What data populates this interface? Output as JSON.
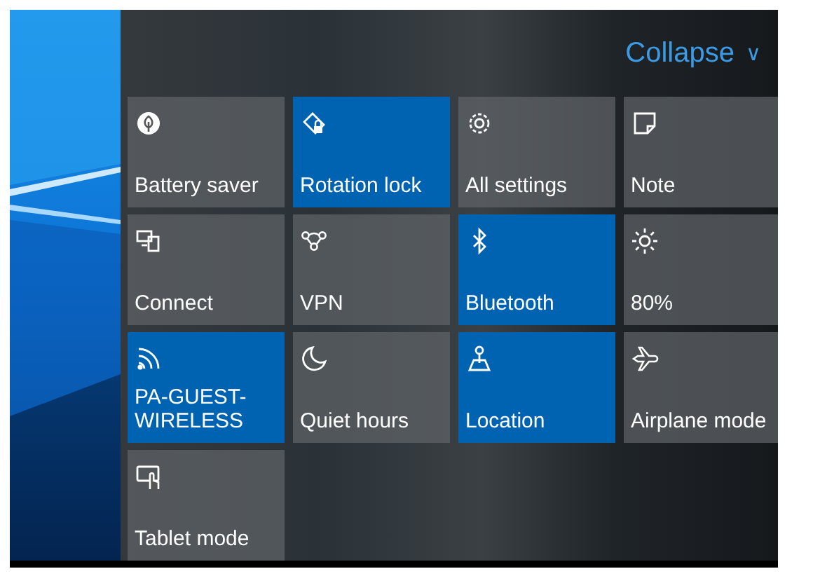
{
  "collapse": {
    "label": "Collapse",
    "caret": "∨"
  },
  "tiles": [
    {
      "label": "Battery saver",
      "on": false
    },
    {
      "label": "Rotation lock",
      "on": true
    },
    {
      "label": "All settings",
      "on": false
    },
    {
      "label": "Note",
      "on": false
    },
    {
      "label": "Connect",
      "on": false
    },
    {
      "label": "VPN",
      "on": false
    },
    {
      "label": "Bluetooth",
      "on": true
    },
    {
      "label": "80%",
      "on": false
    },
    {
      "label": "PA-GUEST-WIRELESS",
      "on": true
    },
    {
      "label": "Quiet hours",
      "on": false
    },
    {
      "label": "Location",
      "on": true
    },
    {
      "label": "Airplane mode",
      "on": false
    },
    {
      "label": "Tablet mode",
      "on": false
    }
  ]
}
